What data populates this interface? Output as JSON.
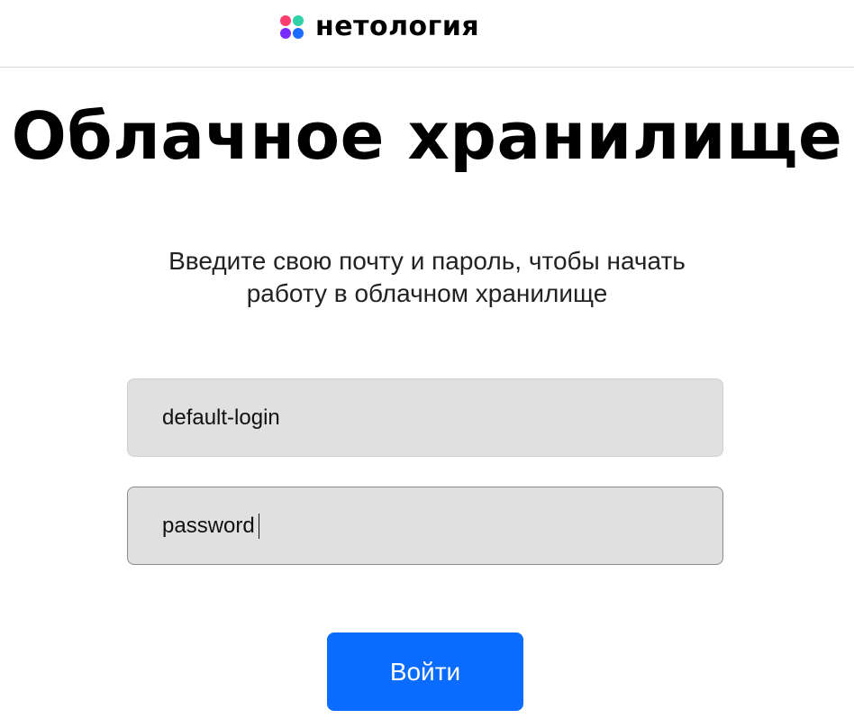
{
  "header": {
    "logo_icon": "netology-four-dots-logo-icon",
    "logo_text": "нетология",
    "logo_colors": [
      "#ff3d6f",
      "#2fd1a6",
      "#7a2cff",
      "#1d6bff"
    ]
  },
  "main": {
    "title": "Облачное хранилище",
    "subtitle_line1": "Введите свою почту и пароль, чтобы начать",
    "subtitle_line2": "работу в облачном хранилище"
  },
  "form": {
    "login_value": "default-login",
    "password_value": "password",
    "submit_label": "Войти",
    "accent_color": "#0a6bff"
  }
}
